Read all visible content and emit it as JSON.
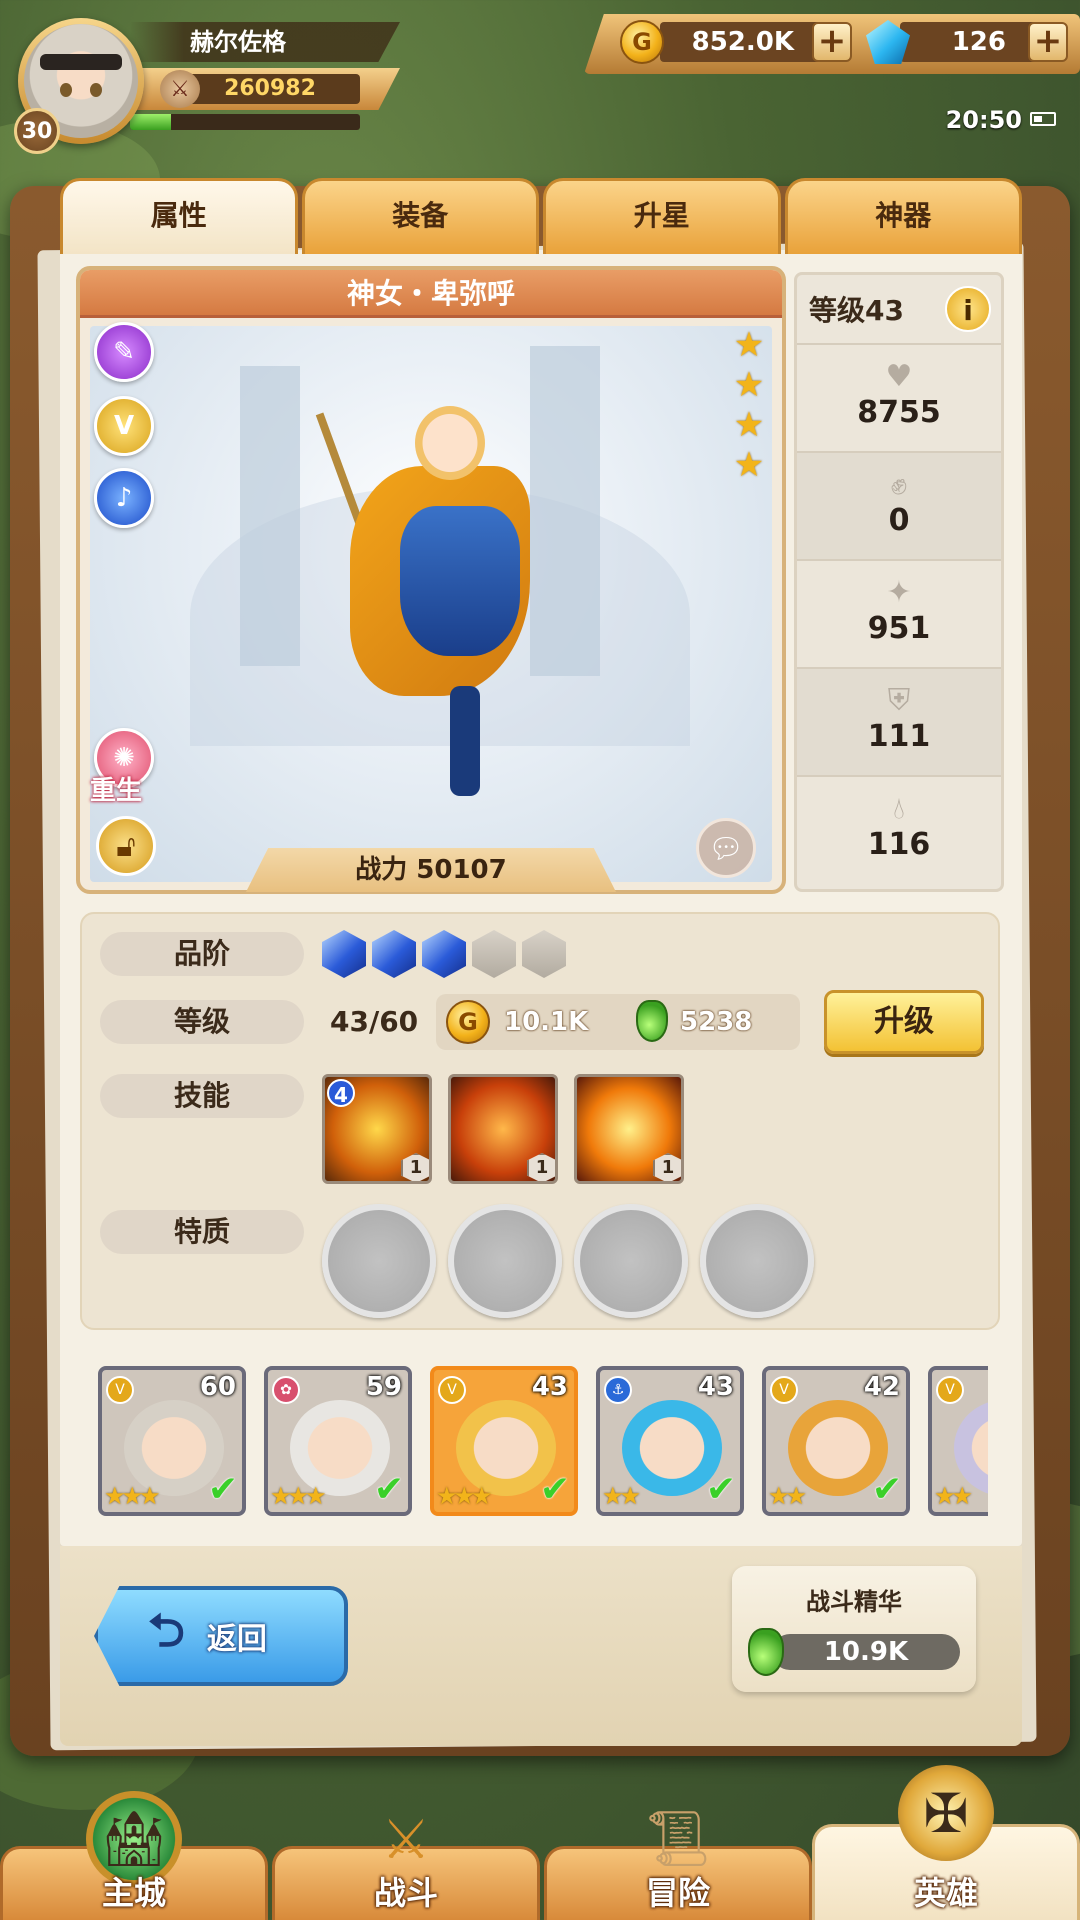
{
  "player": {
    "name": "赫尔佐格",
    "level": "30",
    "power": "260982",
    "exp_fraction": 0.18
  },
  "resources": {
    "gold": "852.0K",
    "gems": "126"
  },
  "status": {
    "time": "20:50"
  },
  "tabs": [
    {
      "label": "属性",
      "active": true
    },
    {
      "label": "装备",
      "active": false
    },
    {
      "label": "升星",
      "active": false
    },
    {
      "label": "神器",
      "active": false
    }
  ],
  "hero": {
    "name": "神女・卑弥呼",
    "stars": 4,
    "combat_power": "战力 50107",
    "rebirth_label": "重生"
  },
  "stats": {
    "level": "等级43",
    "hp": "8755",
    "attack": "0",
    "magic": "951",
    "armor": "111",
    "resist": "116"
  },
  "info": {
    "grade_label": "品阶",
    "grade_filled": 3,
    "grade_total": 5,
    "level_label": "等级",
    "level_value": "43/60",
    "cost_gold": "10.1K",
    "cost_potion": "5238",
    "upgrade_label": "升级",
    "skills_label": "技能",
    "skills": [
      {
        "level": "1",
        "rank": "4"
      },
      {
        "level": "1",
        "rank": ""
      },
      {
        "level": "1",
        "rank": ""
      }
    ],
    "traits_label": "特质"
  },
  "roster": [
    {
      "level": "60",
      "stars": "★★★",
      "selected": false
    },
    {
      "level": "59",
      "stars": "★★★",
      "selected": false
    },
    {
      "level": "43",
      "stars": "★★★",
      "selected": true
    },
    {
      "level": "43",
      "stars": "★★",
      "selected": false
    },
    {
      "level": "42",
      "stars": "★★",
      "selected": false
    },
    {
      "level": "",
      "stars": "★★",
      "selected": false
    }
  ],
  "back_label": "返回",
  "essence": {
    "title": "战斗精华",
    "value": "10.9K"
  },
  "nav": [
    {
      "label": "主城",
      "icon": "castle-icon"
    },
    {
      "label": "战斗",
      "icon": "crossed-swords-icon"
    },
    {
      "label": "冒险",
      "icon": "scroll-map-icon"
    },
    {
      "label": "英雄",
      "icon": "hero-crest-icon",
      "active": true
    }
  ]
}
